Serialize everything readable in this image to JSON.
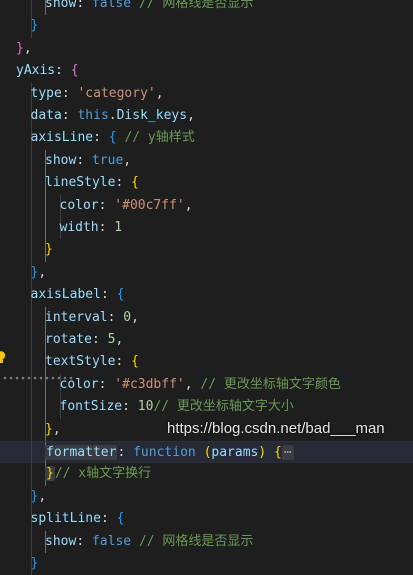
{
  "editor": {
    "lines": [
      {
        "guides": [
          2,
          3
        ],
        "tokens": [
          [
            "k",
            "show"
          ],
          [
            "p",
            ": "
          ],
          [
            "kw",
            "false"
          ],
          [
            "p",
            " "
          ],
          [
            "c",
            "// 网格线是否显示"
          ]
        ]
      },
      {
        "guides": [
          2
        ],
        "tokens": [
          [
            "b3",
            "}"
          ]
        ]
      },
      {
        "guides": [],
        "tokens": [
          [
            "b2",
            "}"
          ],
          [
            "p",
            ","
          ]
        ]
      },
      {
        "guides": [],
        "tokens": [
          [
            "k",
            "yAxis"
          ],
          [
            "p",
            ": "
          ],
          [
            "b2",
            "{"
          ]
        ]
      },
      {
        "guides": [
          2
        ],
        "tokens": [
          [
            "k",
            "type"
          ],
          [
            "p",
            ": "
          ],
          [
            "s",
            "'category'"
          ],
          [
            "p",
            ","
          ]
        ]
      },
      {
        "guides": [
          2
        ],
        "tokens": [
          [
            "k",
            "data"
          ],
          [
            "p",
            ": "
          ],
          [
            "kw",
            "this"
          ],
          [
            "p",
            "."
          ],
          [
            "k",
            "Disk_keys"
          ],
          [
            "p",
            ","
          ]
        ]
      },
      {
        "guides": [
          2
        ],
        "tokens": [
          [
            "k",
            "axisLine"
          ],
          [
            "p",
            ": "
          ],
          [
            "b3",
            "{"
          ],
          [
            "p",
            " "
          ],
          [
            "c",
            "// y轴样式"
          ]
        ]
      },
      {
        "guides": [
          2,
          3
        ],
        "tokens": [
          [
            "k",
            "show"
          ],
          [
            "p",
            ": "
          ],
          [
            "kw",
            "true"
          ],
          [
            "p",
            ","
          ]
        ]
      },
      {
        "guides": [
          2,
          3
        ],
        "tokens": [
          [
            "k",
            "lineStyle"
          ],
          [
            "p",
            ": "
          ],
          [
            "b1",
            "{"
          ]
        ]
      },
      {
        "guides": [
          2,
          3,
          4
        ],
        "tokens": [
          [
            "k",
            "color"
          ],
          [
            "p",
            ": "
          ],
          [
            "s",
            "'#00c7ff'"
          ],
          [
            "p",
            ","
          ]
        ]
      },
      {
        "guides": [
          2,
          3,
          4
        ],
        "tokens": [
          [
            "k",
            "width"
          ],
          [
            "p",
            ": "
          ],
          [
            "n",
            "1"
          ]
        ]
      },
      {
        "guides": [
          2,
          3
        ],
        "tokens": [
          [
            "b1",
            "}"
          ]
        ]
      },
      {
        "guides": [
          2
        ],
        "tokens": [
          [
            "b3",
            "}"
          ],
          [
            "p",
            ","
          ]
        ]
      },
      {
        "guides": [
          2
        ],
        "tokens": [
          [
            "k",
            "axisLabel"
          ],
          [
            "p",
            ": "
          ],
          [
            "b3",
            "{"
          ]
        ]
      },
      {
        "guides": [
          2,
          3
        ],
        "tokens": [
          [
            "k",
            "interval"
          ],
          [
            "p",
            ": "
          ],
          [
            "n",
            "0"
          ],
          [
            "p",
            ","
          ]
        ]
      },
      {
        "guides": [
          2,
          3
        ],
        "tokens": [
          [
            "k",
            "rotate"
          ],
          [
            "p",
            ": "
          ],
          [
            "n",
            "5"
          ],
          [
            "p",
            ","
          ]
        ]
      },
      {
        "guides": [
          2,
          3
        ],
        "tokens": [
          [
            "k",
            "textStyle"
          ],
          [
            "p",
            ": "
          ],
          [
            "b1",
            "{"
          ]
        ]
      },
      {
        "guides": [
          2,
          3,
          4
        ],
        "tokens": [
          [
            "k",
            "color"
          ],
          [
            "p",
            ": "
          ],
          [
            "s",
            "'#c3dbff'"
          ],
          [
            "p",
            ", "
          ],
          [
            "c",
            "// 更改坐标轴文字颜色"
          ]
        ]
      },
      {
        "guides": [
          2,
          3,
          4
        ],
        "tokens": [
          [
            "k",
            "fontSize"
          ],
          [
            "p",
            ": "
          ],
          [
            "n",
            "10"
          ],
          [
            "c",
            "// 更改坐标轴文字大小"
          ]
        ]
      },
      {
        "guides": [
          2,
          3
        ],
        "tokens": [
          [
            "b1",
            "}"
          ],
          [
            "p",
            ","
          ]
        ]
      },
      {
        "guides": [
          2,
          3
        ],
        "highlight": true,
        "tokens": [
          [
            "fnk",
            "formatter"
          ],
          [
            "p",
            ": "
          ],
          [
            "kw",
            "function"
          ],
          [
            "p",
            " "
          ],
          [
            "b1",
            "("
          ],
          [
            "k",
            "params"
          ],
          [
            "b1",
            ")"
          ],
          [
            "p",
            " "
          ],
          [
            "b1",
            "{"
          ],
          [
            "ell",
            "⋯"
          ]
        ]
      },
      {
        "guides": [
          2,
          3
        ],
        "tokens": [
          [
            "fold",
            "}"
          ],
          [
            "c",
            "// x轴文字换行"
          ]
        ]
      },
      {
        "guides": [
          2
        ],
        "tokens": [
          [
            "b3",
            "}"
          ],
          [
            "p",
            ","
          ]
        ]
      },
      {
        "guides": [
          2
        ],
        "tokens": [
          [
            "k",
            "splitLine"
          ],
          [
            "p",
            ": "
          ],
          [
            "b3",
            "{"
          ]
        ]
      },
      {
        "guides": [
          2,
          3
        ],
        "tokens": [
          [
            "k",
            "show"
          ],
          [
            "p",
            ": "
          ],
          [
            "kw",
            "false"
          ],
          [
            "p",
            " "
          ],
          [
            "c",
            "// 网格线是否显示"
          ]
        ]
      },
      {
        "guides": [
          2
        ],
        "tokens": [
          [
            "b3",
            "}"
          ]
        ]
      }
    ],
    "indents": [
      3,
      2,
      1,
      1,
      2,
      2,
      2,
      3,
      3,
      4,
      4,
      3,
      2,
      2,
      3,
      3,
      3,
      4,
      4,
      3,
      3,
      3,
      2,
      2,
      3,
      2
    ]
  },
  "icons": {
    "lightbulb": "lightbulb-icon",
    "error-squiggle": "error-squiggle"
  },
  "colors": {
    "background": "#1e1e1e",
    "lightbulb": "#f5c518",
    "guide": "#404040"
  },
  "watermark": "https://blog.csdn.net/bad___man"
}
